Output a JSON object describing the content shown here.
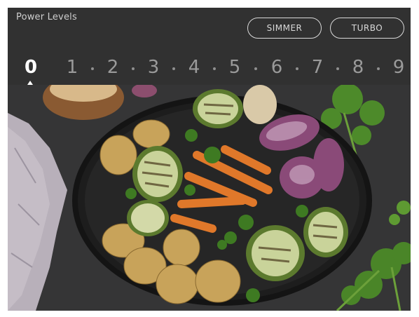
{
  "header": {
    "title": "Power Levels",
    "simmer_label": "SIMMER",
    "turbo_label": "TURBO"
  },
  "levels": {
    "items": [
      "0",
      "1",
      "2",
      "3",
      "4",
      "5",
      "6",
      "7",
      "8",
      "9"
    ],
    "selected": "0"
  },
  "photo": {
    "subject": "grilled vegetables on a black pan"
  },
  "colors": {
    "bar_bg": "#313131",
    "active": "#ffffff",
    "inactive": "#9a9a9a"
  }
}
